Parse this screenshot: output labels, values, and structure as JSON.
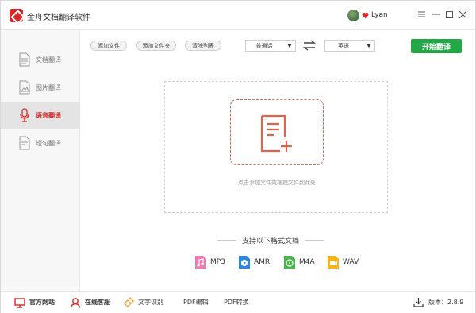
{
  "app": {
    "title": "金舟文档翻译软件",
    "user": "Lyan"
  },
  "colors": {
    "accent": "#d6292a",
    "primary_action": "#26a745",
    "drop_border": "#d9664d"
  },
  "sidebar": {
    "items": [
      {
        "label": "文档翻译",
        "icon": "document-icon",
        "active": false
      },
      {
        "label": "图片翻译",
        "icon": "image-file-icon",
        "active": false
      },
      {
        "label": "语音翻译",
        "icon": "microphone-icon",
        "active": true
      },
      {
        "label": "短句翻译",
        "icon": "text-file-icon",
        "active": false
      }
    ]
  },
  "toolbar": {
    "add_file": "添加文件",
    "add_folder": "添加文件夹",
    "clear_list": "清除列表",
    "source_lang": "普通话",
    "target_lang": "英语",
    "start": "开始翻译"
  },
  "dropzone": {
    "hint": "点击添加文件或拖拽文件到此处"
  },
  "formats": {
    "title": "支持以下格式文档",
    "items": [
      {
        "label": "MP3",
        "icon": "music-file-icon",
        "color": "#f07bb3"
      },
      {
        "label": "AMR",
        "icon": "play-file-icon",
        "color": "#2f86e0"
      },
      {
        "label": "M4A",
        "icon": "film-file-icon",
        "color": "#49b649"
      },
      {
        "label": "WAV",
        "icon": "video-file-icon",
        "color": "#f4b41a"
      }
    ]
  },
  "footer": {
    "website": "官方网站",
    "support": "在线客服",
    "ocr": "文字识别",
    "pdf_edit": "PDF编辑",
    "pdf_convert": "PDF转换",
    "version_label": "版本：",
    "version": "2.8.9"
  }
}
